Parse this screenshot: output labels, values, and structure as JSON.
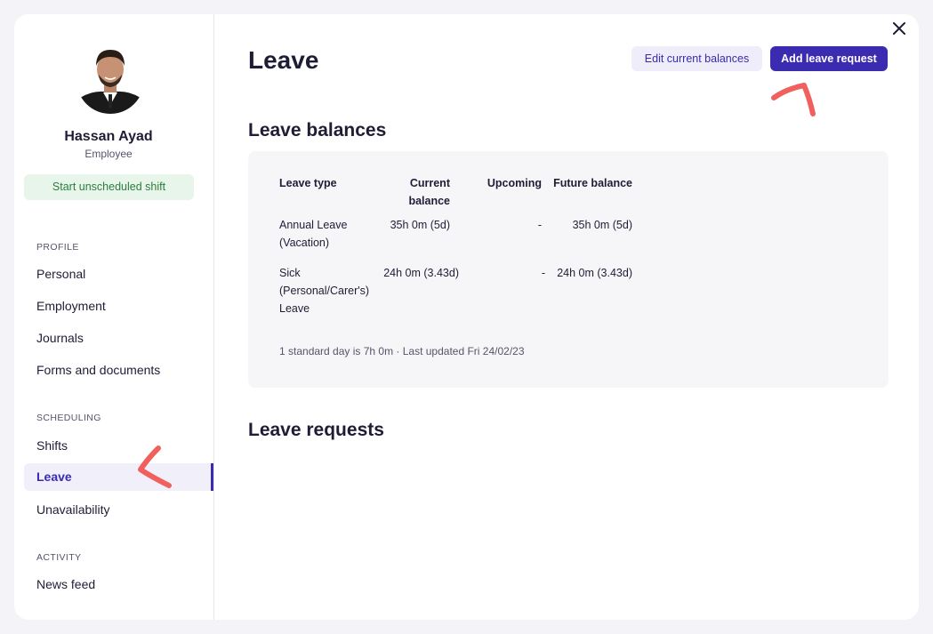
{
  "profile": {
    "name": "Hassan Ayad",
    "role": "Employee",
    "shift_button": "Start unscheduled shift"
  },
  "sidebar": {
    "sections": [
      {
        "label": "PROFILE",
        "items": [
          {
            "label": "Personal"
          },
          {
            "label": "Employment"
          },
          {
            "label": "Journals"
          },
          {
            "label": "Forms and documents"
          }
        ]
      },
      {
        "label": "SCHEDULING",
        "items": [
          {
            "label": "Shifts"
          },
          {
            "label": "Leave",
            "active": true
          },
          {
            "label": "Unavailability"
          }
        ]
      },
      {
        "label": "ACTIVITY",
        "items": [
          {
            "label": "News feed"
          }
        ]
      }
    ]
  },
  "header": {
    "title": "Leave",
    "edit_button": "Edit current balances",
    "add_button": "Add leave request"
  },
  "balances": {
    "title": "Leave balances",
    "columns": {
      "type": "Leave type",
      "current_1": "Current",
      "current_2": "balance",
      "upcoming": "Upcoming",
      "future": "Future balance"
    },
    "rows": [
      {
        "type_1": "Annual Leave",
        "type_2": "(Vacation)",
        "type_3": "",
        "current": "35h 0m (5d)",
        "upcoming": "-",
        "future": "35h 0m (5d)"
      },
      {
        "type_1": "Sick",
        "type_2": "(Personal/Carer's)",
        "type_3": "Leave",
        "current": "24h 0m (3.43d)",
        "upcoming": "-",
        "future": "24h 0m (3.43d)"
      }
    ],
    "footnote": "1 standard day is 7h 0m · Last updated Fri 24/02/23"
  },
  "requests": {
    "title": "Leave requests"
  },
  "colors": {
    "accent": "#3a2bb0",
    "annotation": "#f0605d",
    "success_bg": "#e8f5ea",
    "success_text": "#2d7d3b"
  }
}
